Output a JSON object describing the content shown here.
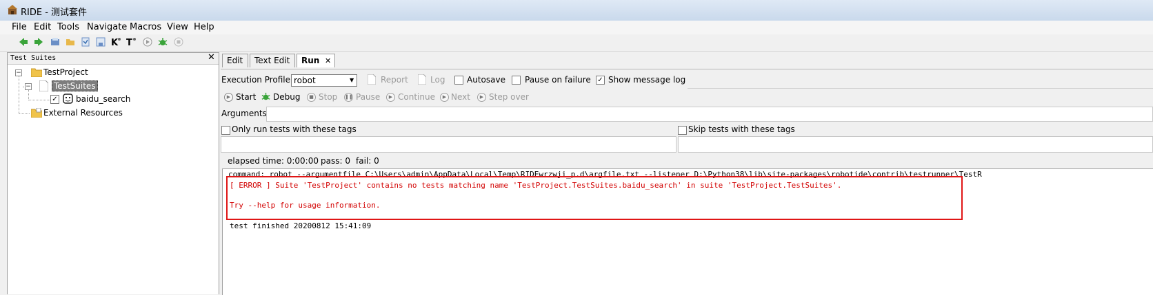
{
  "window": {
    "title": "RIDE - 测试套件"
  },
  "menu": [
    "File",
    "Edit",
    "Tools",
    "Navigate",
    "Macros",
    "View",
    "Help"
  ],
  "toolbar": {
    "icons": [
      "back-icon",
      "forward-icon",
      "open-icon",
      "open-dir-icon",
      "open-resource-icon",
      "save-icon",
      "save-all-icon",
      "search-keyword-icon",
      "search-test-icon",
      "run-icon",
      "debug-icon",
      "stop-icon"
    ]
  },
  "tree": {
    "panel_title": "Test Suites",
    "close": "✕",
    "nodes": [
      {
        "label": "TestProject"
      },
      {
        "label": "TestSuites"
      },
      {
        "label": "baidu_search"
      },
      {
        "label": "External Resources"
      }
    ]
  },
  "tabs": [
    "Edit",
    "Text Edit",
    "Run"
  ],
  "tab_close": "✕",
  "run": {
    "profile_label": "Execution Profile:",
    "profile_value": "robot",
    "report": "Report",
    "log": "Log",
    "autosave": "Autosave",
    "pause_on_failure": "Pause on failure",
    "show_message_log": "Show message log",
    "start": "Start",
    "debug": "Debug",
    "stop": "Stop",
    "pause": "Pause",
    "continue": "Continue",
    "next": "Next",
    "step_over": "Step over",
    "arguments_label": "Arguments:",
    "only_run_tags": "Only run tests with these tags",
    "skip_tags": "Skip tests with these tags",
    "elapsed": "elapsed time: 0:00:00",
    "pass": "pass: 0",
    "fail": "fail: 0"
  },
  "output": {
    "command": "command: robot --argumentfile C:\\Users\\admin\\AppData\\Local\\Temp\\RIDEwrzwji_p.d\\argfile.txt --listener D:\\Python38\\lib\\site-packages\\robotide\\contrib\\testrunner\\TestR",
    "error": "[ ERROR ] Suite 'TestProject' contains no tests matching name 'TestProject.TestSuites.baidu_search' in suite 'TestProject.TestSuites'.",
    "help": "Try --help for usage information.",
    "finished": "test finished 20200812 15:41:09"
  },
  "colors": {
    "error_text": "#d20000",
    "error_box": "#e01515",
    "selection": "#7d7d7d"
  }
}
